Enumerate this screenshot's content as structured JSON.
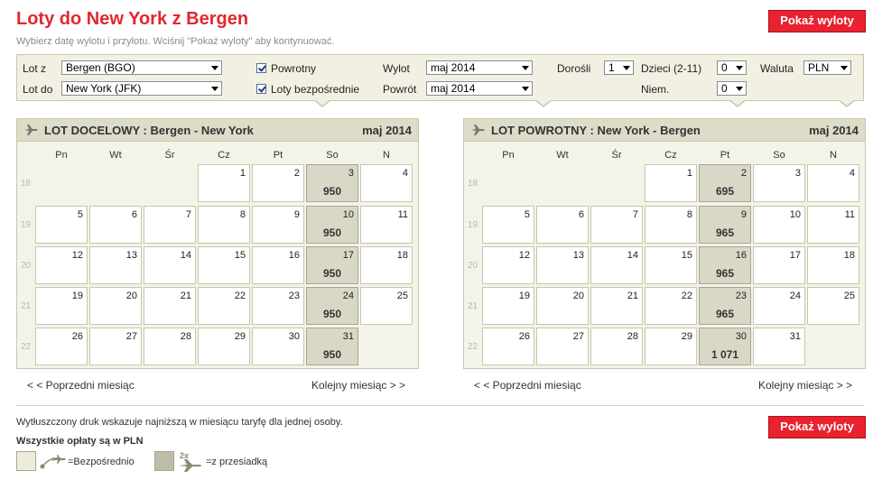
{
  "header": {
    "title": "Loty do New York z Bergen",
    "subtitle": "Wybierz datę wylotu i przylotu. Wciśnij \"Pokaż wyloty\" aby kontynuować.",
    "show_button": "Pokaż wyloty"
  },
  "form": {
    "from_label": "Lot z",
    "from_value": "Bergen (BGO)",
    "to_label": "Lot do",
    "to_value": "New York (JFK)",
    "return_label": "Powrotny",
    "return_checked": true,
    "direct_label": "Loty bezpośrednie",
    "direct_checked": true,
    "depart_label": "Wylot",
    "depart_value": "maj 2014",
    "back_label": "Powrót",
    "back_value": "maj 2014",
    "adults_label": "Dorośli",
    "adults_value": "1",
    "children_label": "Dzieci (2-11)",
    "children_value": "0",
    "infants_label": "Niem.",
    "infants_value": "0",
    "currency_label": "Waluta",
    "currency_value": "PLN"
  },
  "weekdays": [
    "Pn",
    "Wt",
    "Śr",
    "Cz",
    "Pt",
    "So",
    "N"
  ],
  "weeks": [
    "18",
    "19",
    "20",
    "21",
    "22"
  ],
  "outbound": {
    "title": "LOT DOCELOWY :  Bergen - New York",
    "month": "maj 2014",
    "prev": "< < Poprzedni miesiąc",
    "next": "Kolejny miesiąc > >",
    "prices": {
      "3": "950",
      "10": "950",
      "17": "950",
      "24": "950",
      "31": "950"
    }
  },
  "inbound": {
    "title": "LOT POWROTNY :  New York - Bergen",
    "month": "maj 2014",
    "prev": "< < Poprzedni miesiąc",
    "next": "Kolejny miesiąc > >",
    "prices": {
      "2": "695",
      "9": "965",
      "16": "965",
      "23": "965",
      "30": "1 071"
    }
  },
  "footer": {
    "note": "Wytłuszczony druk wskazuje najniższą w miesiącu taryfę dla jednej osoby.",
    "currency_note": "Wszystkie opłaty są w PLN",
    "legend_direct": "=Bezpośrednio",
    "legend_transfer": "=z przesiadką",
    "legend_transfer_badge": "2x"
  },
  "colors": {
    "accent": "#e0282e",
    "button": "#e8222e",
    "panel": "#f1f0e3",
    "highlight": "#d9d8c6"
  }
}
